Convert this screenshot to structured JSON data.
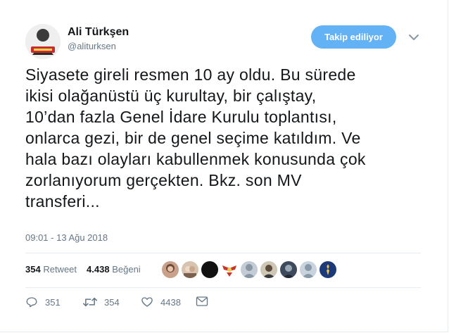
{
  "author": {
    "name": "Ali Türkşen",
    "handle": "@aliturksen",
    "avatar_icon": "profile-avatar"
  },
  "follow_button": {
    "label": "Takip ediliyor",
    "color": "#63b2f5"
  },
  "tweet": {
    "text": "Siyasete gireli resmen 10 ay oldu. Bu sürede\nikisi olağanüstü üç kurultay, bir çalıştay,\n10’dan fazla Genel İdare Kurulu toplantısı,\nonlarca gezi, bir de genel seçime katıldım. Ve\nhala bazı olayları kabullenmek konusunda çok\nzorlanıyorum gerçekten. Bkz. son MV\ntransferi...",
    "timestamp": "09:01 - 13 Ağu 2018"
  },
  "stats": {
    "retweet_count": "354",
    "retweet_label": "Retweet",
    "like_count": "4.438",
    "like_label": "Beğeni"
  },
  "likers": [
    {
      "icon": "liker-avatar-1",
      "color": "#c9a089"
    },
    {
      "icon": "liker-avatar-2",
      "color": "#d8c2b0"
    },
    {
      "icon": "liker-avatar-3",
      "color": "#111111"
    },
    {
      "icon": "liker-avatar-4",
      "color": "#c8362a"
    },
    {
      "icon": "liker-avatar-5",
      "color": "#9aa5b1"
    },
    {
      "icon": "liker-avatar-6",
      "color": "#7a6f5c"
    },
    {
      "icon": "liker-avatar-7",
      "color": "#3e4a5c"
    },
    {
      "icon": "liker-avatar-8",
      "color": "#a9b6c3"
    },
    {
      "icon": "liker-avatar-9",
      "color": "#1d3a78"
    }
  ],
  "actions": {
    "reply_count": "351",
    "retweet_count": "354",
    "like_count": "4438"
  },
  "colors": {
    "text": "#14171a",
    "muted": "#657786",
    "divider": "#e6ecf0"
  }
}
